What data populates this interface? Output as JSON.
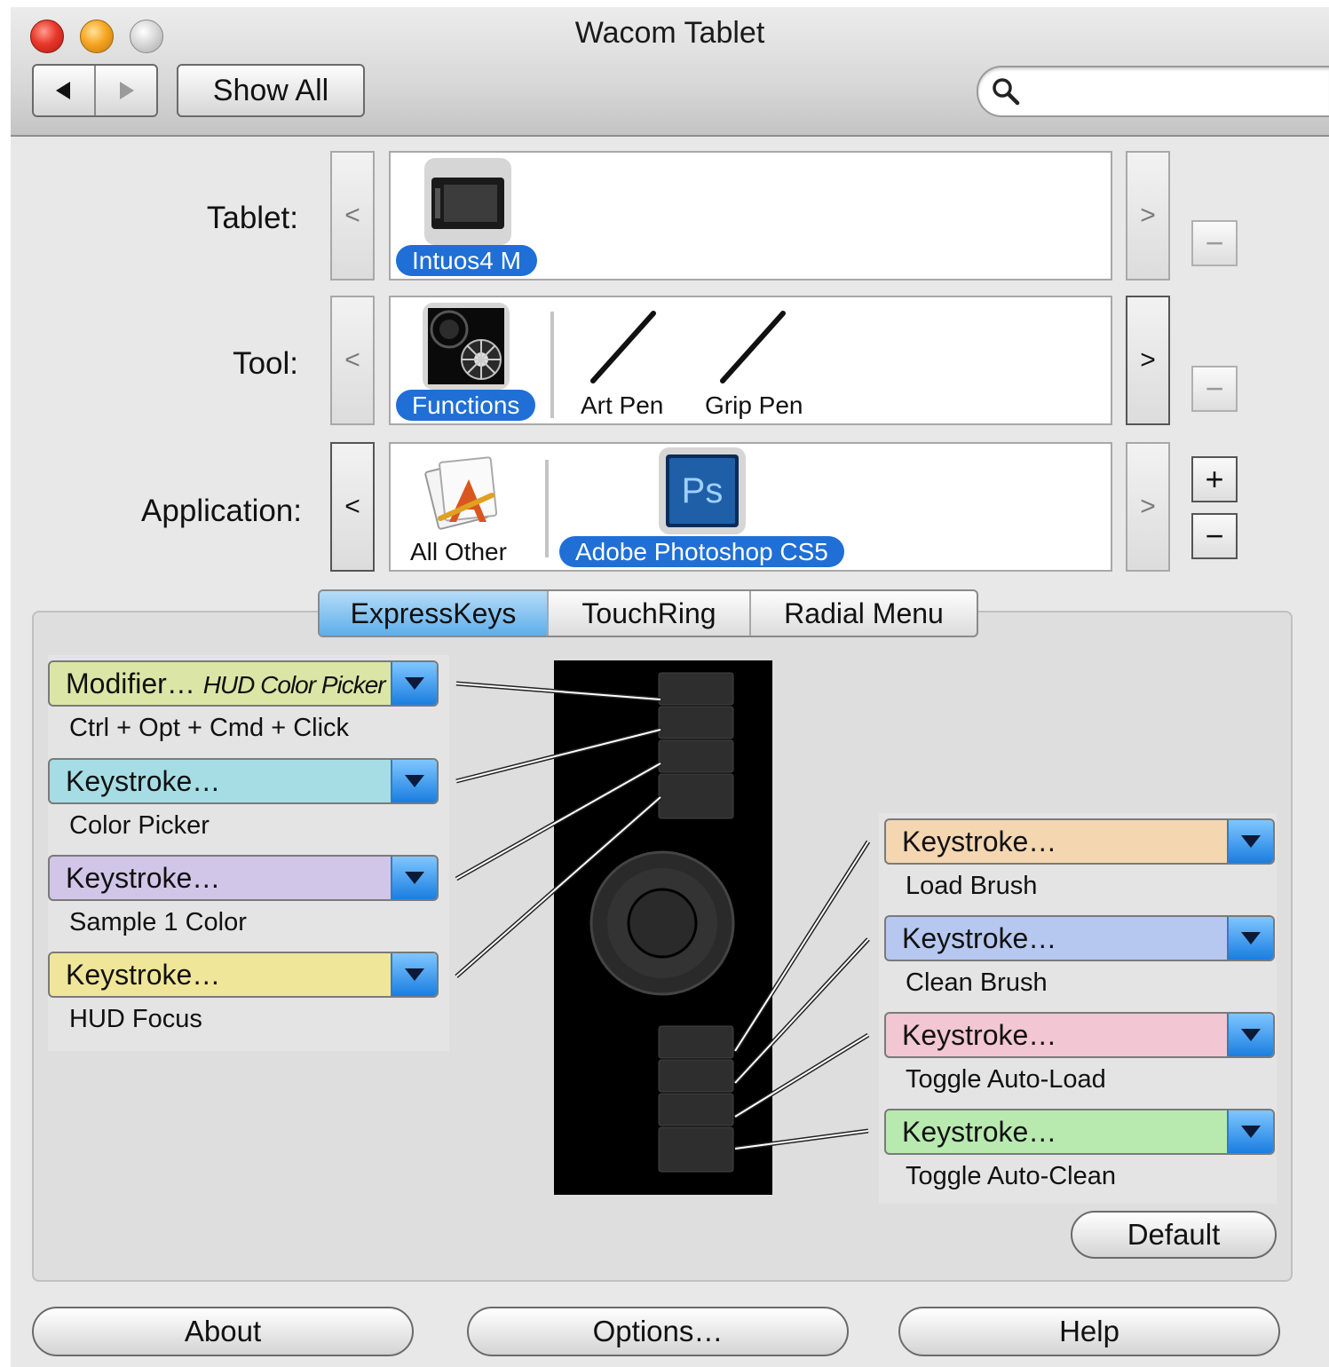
{
  "window": {
    "title": "Wacom Tablet"
  },
  "toolbar": {
    "back_icon": "back-arrow-icon",
    "forward_icon": "forward-arrow-icon",
    "show_all_label": "Show All",
    "search_placeholder": "",
    "search_icon": "search-icon"
  },
  "rows": {
    "tablet": {
      "label": "Tablet:",
      "prev": "<",
      "next": ">",
      "remove": "−",
      "items": [
        {
          "label": "Intuos4 M",
          "selected": true,
          "icon": "tablet-icon"
        }
      ]
    },
    "tool": {
      "label": "Tool:",
      "prev": "<",
      "next": ">",
      "remove": "−",
      "items": [
        {
          "label": "Functions",
          "selected": true,
          "icon": "functions-icon"
        },
        {
          "label": "Art Pen",
          "selected": false,
          "icon": "pen-icon"
        },
        {
          "label": "Grip Pen",
          "selected": false,
          "icon": "pen-icon"
        }
      ]
    },
    "application": {
      "label": "Application:",
      "prev": "<",
      "next": ">",
      "add": "+",
      "remove": "−",
      "items": [
        {
          "label": "All Other",
          "selected": false,
          "icon": "applications-icon"
        },
        {
          "label": "Adobe Photoshop CS5",
          "selected": true,
          "icon": "photoshop-icon",
          "icon_text": "Ps"
        }
      ]
    }
  },
  "tabs": [
    {
      "label": "ExpressKeys",
      "selected": true
    },
    {
      "label": "TouchRing",
      "selected": false
    },
    {
      "label": "Radial Menu",
      "selected": false
    }
  ],
  "left_keys": [
    {
      "popup": "Modifier…",
      "popup_suffix": "HUD Color Picker",
      "function": "Ctrl + Opt + Cmd + Click",
      "color": "#dbe6a6"
    },
    {
      "popup": "Keystroke…",
      "function": "Color Picker",
      "color": "#a6dde4"
    },
    {
      "popup": "Keystroke…",
      "function": "Sample 1 Color",
      "color": "#d2c6e8"
    },
    {
      "popup": "Keystroke…",
      "function": "HUD Focus",
      "color": "#f0e69a"
    }
  ],
  "right_keys": [
    {
      "popup": "Keystroke…",
      "function": "Load Brush",
      "color": "#f4d6b0"
    },
    {
      "popup": "Keystroke…",
      "function": "Clean Brush",
      "color": "#b6c8f0"
    },
    {
      "popup": "Keystroke…",
      "function": "Toggle Auto-Load",
      "color": "#f2c6d2"
    },
    {
      "popup": "Keystroke…",
      "function": "Toggle Auto-Clean",
      "color": "#b8eab0"
    }
  ],
  "default_label": "Default",
  "bottom": {
    "about": "About",
    "options": "Options…",
    "help": "Help"
  },
  "colors": {
    "selection": "#1f6fd6",
    "tab_selected": "#5eaeea",
    "popup_arrow": "#1a7ee0"
  }
}
